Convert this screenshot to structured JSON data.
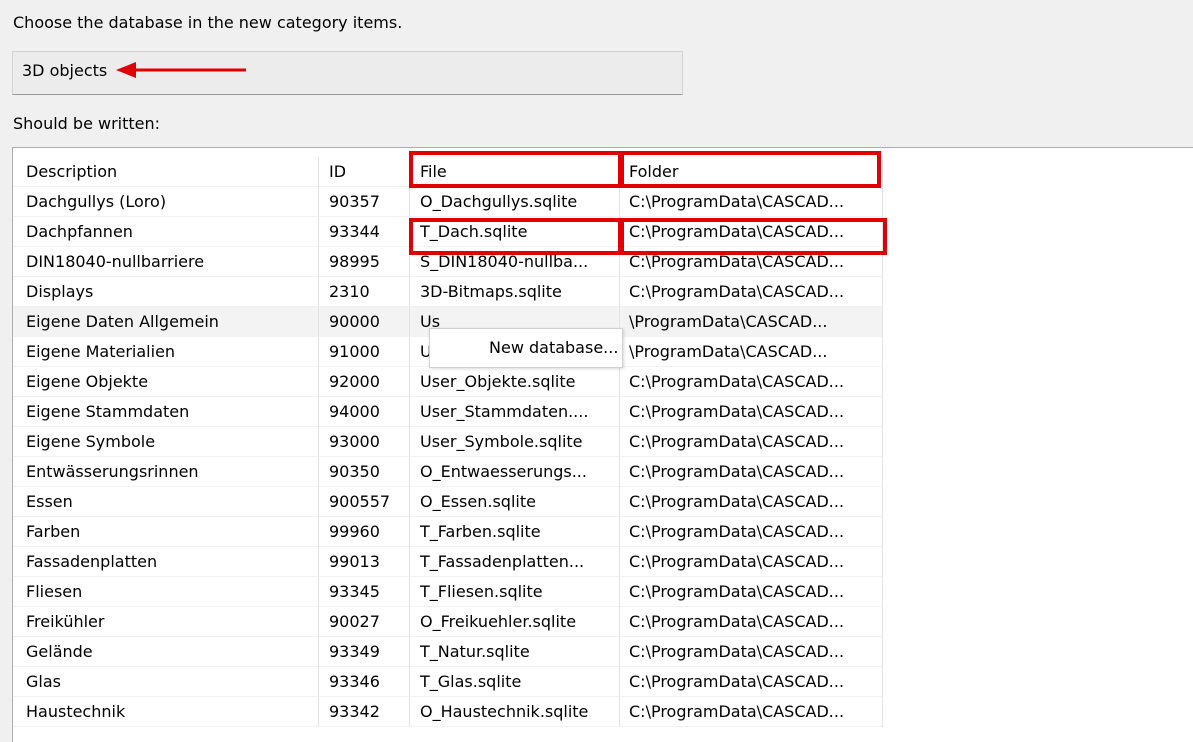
{
  "instruction": "Choose the database in the new category items.",
  "category": {
    "value": "3D objects"
  },
  "written_label": "Should be written:",
  "table": {
    "headers": {
      "description": "Description",
      "id": "ID",
      "file": "File",
      "folder": "Folder"
    },
    "rows": [
      {
        "description": "Dachgullys (Loro)",
        "id": "90357",
        "file": "O_Dachgullys.sqlite",
        "folder": "C:\\ProgramData\\CASCAD..."
      },
      {
        "description": "Dachpfannen",
        "id": "93344",
        "file": "T_Dach.sqlite",
        "folder": "C:\\ProgramData\\CASCAD..."
      },
      {
        "description": "DIN18040-nullbarriere",
        "id": "98995",
        "file": "S_DIN18040-nullba...",
        "folder": "C:\\ProgramData\\CASCAD..."
      },
      {
        "description": "Displays",
        "id": "2310",
        "file": "3D-Bitmaps.sqlite",
        "folder": "C:\\ProgramData\\CASCAD..."
      },
      {
        "description": "Eigene Daten Allgemein",
        "id": "90000",
        "file": "Us",
        "folder": "\\ProgramData\\CASCAD..."
      },
      {
        "description": "Eigene Materialien",
        "id": "91000",
        "file": "Us",
        "folder": "\\ProgramData\\CASCAD..."
      },
      {
        "description": "Eigene Objekte",
        "id": "92000",
        "file": "User_Objekte.sqlite",
        "folder": "C:\\ProgramData\\CASCAD..."
      },
      {
        "description": "Eigene Stammdaten",
        "id": "94000",
        "file": "User_Stammdaten....",
        "folder": "C:\\ProgramData\\CASCAD..."
      },
      {
        "description": "Eigene Symbole",
        "id": "93000",
        "file": "User_Symbole.sqlite",
        "folder": "C:\\ProgramData\\CASCAD..."
      },
      {
        "description": "Entwässerungsrinnen",
        "id": "90350",
        "file": "O_Entwaesserungs...",
        "folder": "C:\\ProgramData\\CASCAD..."
      },
      {
        "description": "Essen",
        "id": "900557",
        "file": "O_Essen.sqlite",
        "folder": "C:\\ProgramData\\CASCAD..."
      },
      {
        "description": "Farben",
        "id": "99960",
        "file": "T_Farben.sqlite",
        "folder": "C:\\ProgramData\\CASCAD..."
      },
      {
        "description": "Fassadenplatten",
        "id": "99013",
        "file": "T_Fassadenplatten...",
        "folder": "C:\\ProgramData\\CASCAD..."
      },
      {
        "description": "Fliesen",
        "id": "93345",
        "file": "T_Fliesen.sqlite",
        "folder": "C:\\ProgramData\\CASCAD..."
      },
      {
        "description": "Freikühler",
        "id": "90027",
        "file": "O_Freikuehler.sqlite",
        "folder": "C:\\ProgramData\\CASCAD..."
      },
      {
        "description": "Gelände",
        "id": "93349",
        "file": "T_Natur.sqlite",
        "folder": "C:\\ProgramData\\CASCAD..."
      },
      {
        "description": "Glas",
        "id": "93346",
        "file": "T_Glas.sqlite",
        "folder": "C:\\ProgramData\\CASCAD..."
      },
      {
        "description": "Haustechnik",
        "id": "93342",
        "file": "O_Haustechnik.sqlite",
        "folder": "C:\\ProgramData\\CASCAD..."
      }
    ]
  },
  "context_menu": {
    "item": "New database..."
  },
  "colors": {
    "highlight": "#e00000",
    "arrow": "#e00000"
  }
}
